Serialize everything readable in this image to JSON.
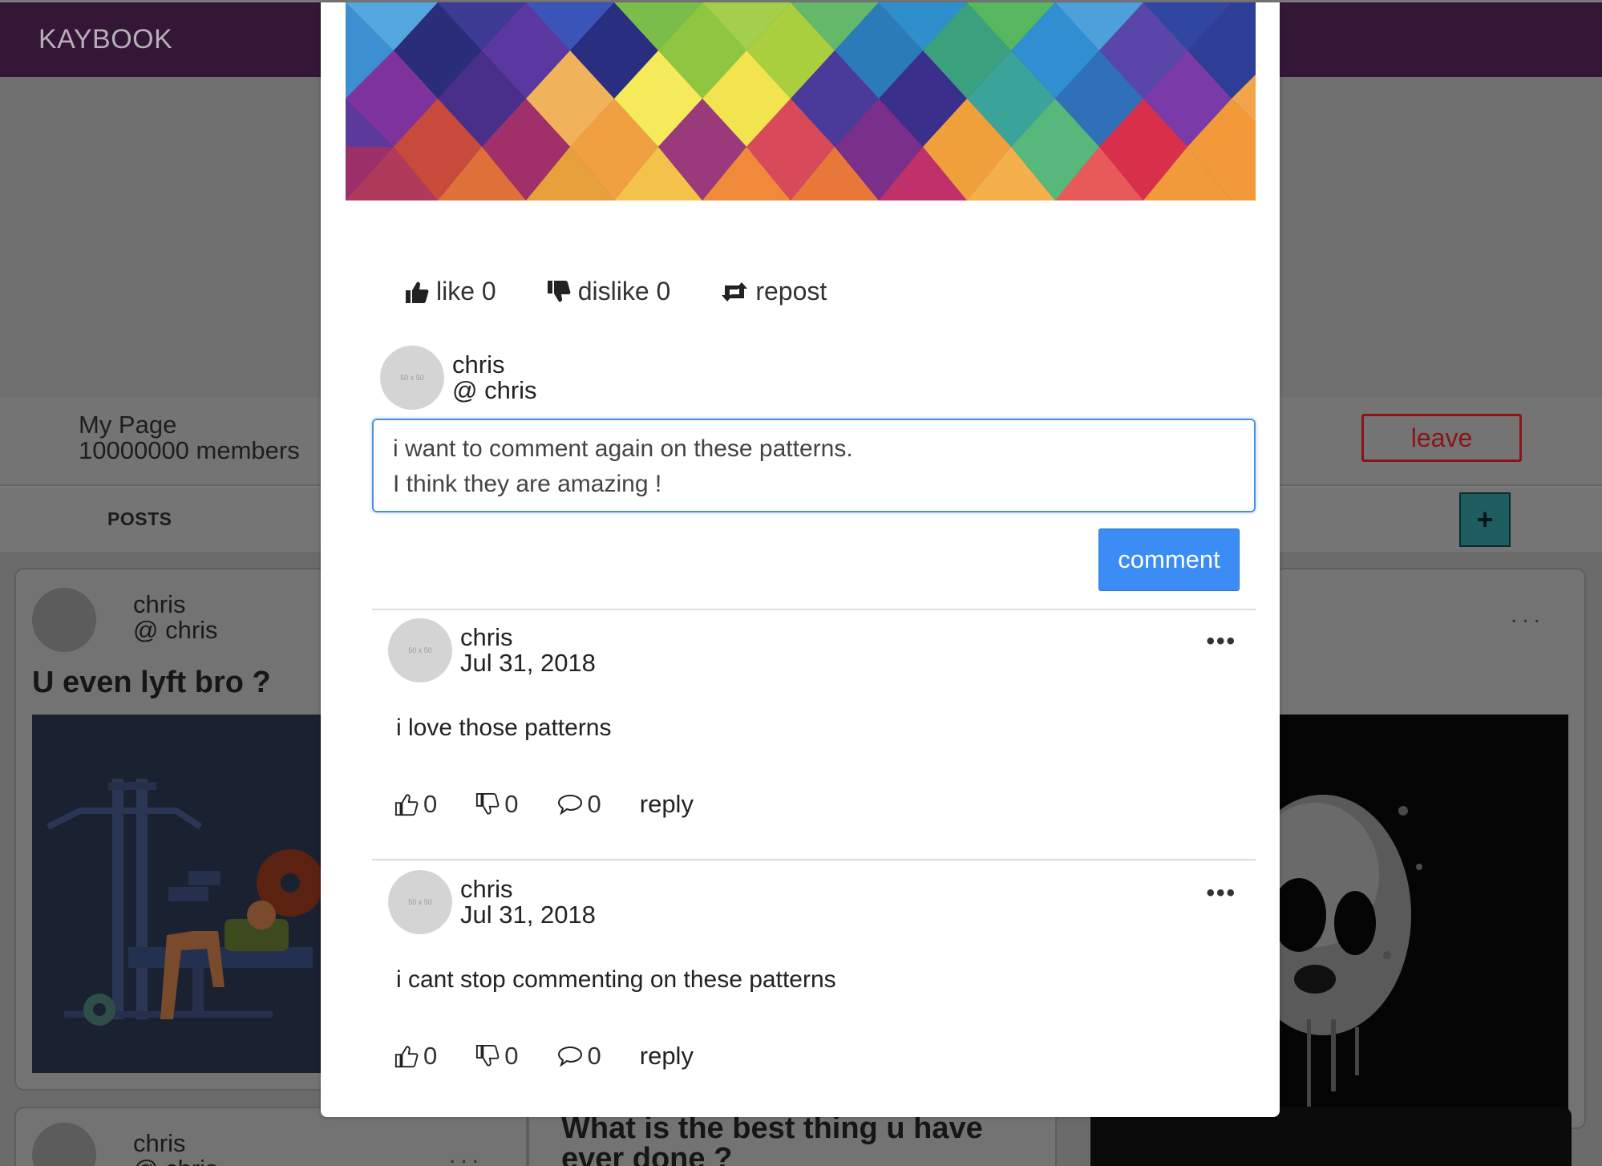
{
  "app": {
    "brand": "KAYBOOK"
  },
  "group": {
    "name": "My Page",
    "members": "10000000 members",
    "leave_label": "leave",
    "tab_posts": "POSTS",
    "add_label": "+"
  },
  "feed": {
    "post1": {
      "author": "chris",
      "handle": "@ chris",
      "title": "U even lyft bro ?"
    },
    "post2": {
      "dots": "..."
    },
    "post3": {
      "author": "chris",
      "handle": "@ chris",
      "dots": "..."
    },
    "post4": {
      "title": "What is the best thing u have ever done ?"
    }
  },
  "modal": {
    "actions": {
      "like": "like 0",
      "dislike": "dislike 0",
      "repost": "repost"
    },
    "current_user": {
      "name": "chris",
      "handle": "@ chris",
      "avatar_text": "50 x 50"
    },
    "comment_input": {
      "value": "i want to comment again on these patterns.\nI think they are amazing !"
    },
    "comment_button": "comment",
    "comments": [
      {
        "author": "chris",
        "date": "Jul 31, 2018",
        "text": "i love those patterns",
        "likes": "0",
        "dislikes": "0",
        "replies": "0",
        "reply_label": "reply",
        "menu": "•••",
        "avatar_text": "50 x 50"
      },
      {
        "author": "chris",
        "date": "Jul 31, 2018",
        "text": "i cant stop commenting on these patterns",
        "likes": "0",
        "dislikes": "0",
        "replies": "0",
        "reply_label": "reply",
        "menu": "•••",
        "avatar_text": "50 x 50"
      }
    ]
  },
  "colors": {
    "topbar": "#341736",
    "accent_blue": "#3b8cf5",
    "input_focus": "#4a90e2",
    "leave_red": "#8a1515",
    "add_teal": "#1e5e60"
  }
}
